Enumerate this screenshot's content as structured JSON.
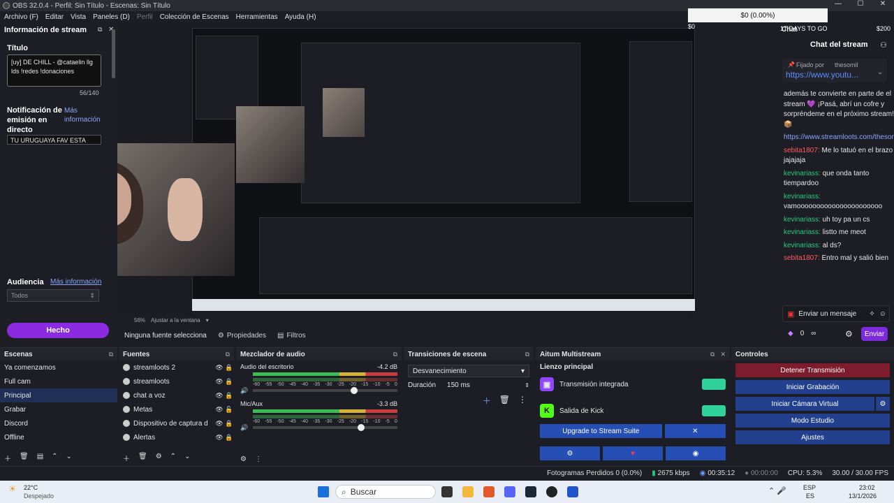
{
  "window": {
    "title": "OBS 32.0.4 - Perfil: Sin Título - Escenas: Sin Título"
  },
  "menu": [
    "Archivo (F)",
    "Editar",
    "Vista",
    "Paneles (D)",
    "Perfil",
    "Colección de Escenas",
    "Herramientas",
    "Ayuda (H)"
  ],
  "overlay": {
    "balance": "$0 (0.00%)",
    "days": "17 DAYS TO GO",
    "goal": "$200",
    "left_value": "$0"
  },
  "stream_info": {
    "panel_title": "Información de stream",
    "title_label": "Título",
    "title_value": "[uy] DE CHILL - @cataelin llg lds !redes !donaciones",
    "char_count": "56/140",
    "notification_label": "Notificación de emisión en directo",
    "more_info": "Más información",
    "notification_value": "TU URUGUAYA FAV ESTA",
    "audience_label": "Audiencia",
    "audience_more": "Más información",
    "audience_value": "Todos",
    "done": "Hecho"
  },
  "preview": {
    "zoom": "56%",
    "fit": "Ajustar a la ventana"
  },
  "chat": {
    "header": "Chat",
    "title": "Chat del stream",
    "pinned_by": "Fijado por",
    "pinned_user": "thesomil",
    "pinned_link": "https://www.youtu...",
    "messages": [
      {
        "user": "",
        "text": "además te convierte en parte de el stream 💜 ¡Pasá, abrí un cofre y sorpréndeme en el próximo stream! 📦"
      },
      {
        "user": "",
        "text": "https://www.streamloots.com/thesomil"
      },
      {
        "user": "sebita1807:",
        "text": "Me lo tatuó en el brazo jajajaja",
        "color": "#ff5c5c"
      },
      {
        "user": "kevinariass:",
        "text": "que onda tanto tiempardoo",
        "color": "#27c97c"
      },
      {
        "user": "kevinariass:",
        "text": "vamoooooooooooooooooooooo",
        "color": "#27c97c"
      },
      {
        "user": "kevinariass:",
        "text": "uh toy pa un cs",
        "color": "#27c97c"
      },
      {
        "user": "kevinariass:",
        "text": "listto me meot",
        "color": "#27c97c"
      },
      {
        "user": "kevinariass:",
        "text": "al ds?",
        "color": "#27c97c"
      },
      {
        "user": "sebita1807:",
        "text": "Entro mal y salió bien",
        "color": "#ff5c5c"
      }
    ],
    "send_placeholder": "Enviar un mensaje",
    "points": "0",
    "send_btn": "Enviar"
  },
  "context": {
    "source_label": "Ninguna fuente selecciona",
    "properties": "Propiedades",
    "filters": "Filtros"
  },
  "scenes": {
    "title": "Escenas",
    "items": [
      "Ya comenzamos",
      "Full cam",
      "Principal",
      "Grabar",
      "Discord",
      "Offline"
    ],
    "selected": 2
  },
  "sources": {
    "title": "Fuentes",
    "items": [
      "streamloots 2",
      "streamloots",
      "chat a voz",
      "Metas",
      "Dispositivo de captura d",
      "Alertas"
    ]
  },
  "mixer": {
    "title": "Mezclador de audio",
    "channels": [
      {
        "name": "Audio del escritorio",
        "db": "-4.2 dB",
        "level": 0.7
      },
      {
        "name": "Mic/Aux",
        "db": "-3.3 dB",
        "level": 0.75
      }
    ],
    "scale": [
      "-60",
      "-55",
      "-50",
      "-45",
      "-40",
      "-35",
      "-30",
      "-25",
      "-20",
      "-15",
      "-10",
      "-5",
      "0"
    ]
  },
  "transitions": {
    "title": "Transiciones de escena",
    "type": "Desvanecimiento",
    "duration_label": "Duración",
    "duration_value": "150 ms"
  },
  "multistream": {
    "title": "Aitum Multistream",
    "canvas": "Lienzo principal",
    "outputs": [
      {
        "name": "Transmisión integrada",
        "icon": "twitch-icon",
        "color": "#9146ff"
      },
      {
        "name": "Salida de Kick",
        "icon": "kick-icon",
        "color": "#53fc18"
      }
    ],
    "upgrade": "Upgrade to Stream Suite"
  },
  "controls": {
    "title": "Controles",
    "buttons": [
      "Detener Transmisión",
      "Iniciar Grabación",
      "Iniciar Cámara Virtual",
      "Modo Estudio",
      "Ajustes"
    ]
  },
  "status": {
    "frames": "Fotogramas Perdidos 0 (0.0%)",
    "bitrate": "2675 kbps",
    "time": "00:35:12",
    "rec": "00:00:00",
    "cpu": "CPU: 5.3%",
    "fps": "30.00 / 30.00 FPS"
  },
  "taskbar": {
    "temp": "22°C",
    "weather": "Despejado",
    "search": "Buscar",
    "lang": "ESP",
    "lang2": "ES",
    "clock": "23:02",
    "date": "13/1/2026"
  }
}
